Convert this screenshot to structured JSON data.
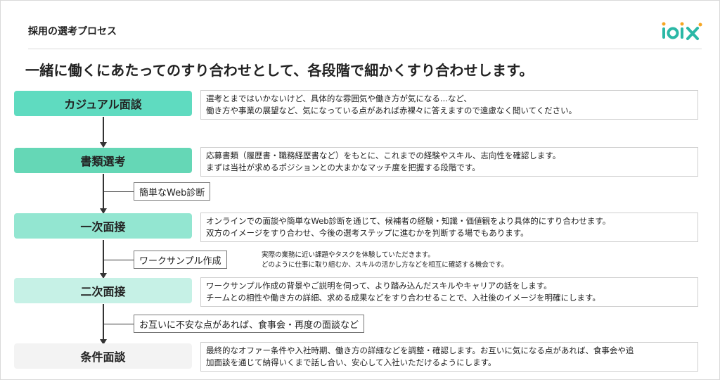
{
  "header": {
    "title": "採用の選考プロセス",
    "logo_text": "ιοιχ"
  },
  "headline": "一緒に働くにあたってのすり合わせとして、各段階で細かくすり合わせします。",
  "colors": {
    "stage1": "#5fdbc0",
    "stage2": "#65d7b6",
    "stage3": "#93e6d1",
    "stage4": "#c6f1e6",
    "stage5": "#f3f3f3",
    "logo_teal": "#2bb8a6",
    "logo_orange": "#f5a623"
  },
  "stages": [
    {
      "label": "カジュアル面談",
      "desc": [
        "選考とまではいかないけど、具体的な雰囲気や働き方が気になる...など、",
        "働き方や事業の展望など、気になっている点があれば赤裸々に答えますので遠慮なく聞いてください。"
      ]
    },
    {
      "label": "書類選考",
      "desc": [
        "応募書類（履歴書・職務経歴書など）をもとに、これまでの経験やスキル、志向性を確認します。",
        "まずは当社が求めるポジションとの大まかなマッチ度を把握する段階です。"
      ]
    },
    {
      "label": "一次面接",
      "desc": [
        "オンラインでの面談や簡単なWeb診断を通じて、候補者の経験・知識・価値観をより具体的にすり合わせます。",
        "双方のイメージをすり合わせ、今後の選考ステップに進むかを判断する場でもあります。"
      ]
    },
    {
      "label": "二次面接",
      "desc": [
        "ワークサンプル作成の背景やご説明を伺って、より踏み込んだスキルやキャリアの話をします。",
        "チームとの相性や働き方の詳細、求める成果などをすり合わせることで、入社後のイメージを明確にします。"
      ]
    },
    {
      "label": "条件面談",
      "desc": [
        "最終的なオファー条件や入社時期、働き方の詳細などを調整・確認します。お互いに気になる点があれば、食事会や追",
        "加面談を通じて納得いくまで話し合い、安心して入社いただけるようにします。"
      ]
    }
  ],
  "sub_steps": [
    {
      "label": "簡単なWeb診断"
    },
    {
      "label": "ワークサンプル作成"
    },
    {
      "label": "お互いに不安な点があれば、食事会・再度の面談など"
    }
  ],
  "work_sample_note": [
    "実際の業務に近い課題やタスクを体験していただきます。",
    "どのように仕事に取り組むか、スキルの活かし方などを相互に確認する機会です。"
  ]
}
